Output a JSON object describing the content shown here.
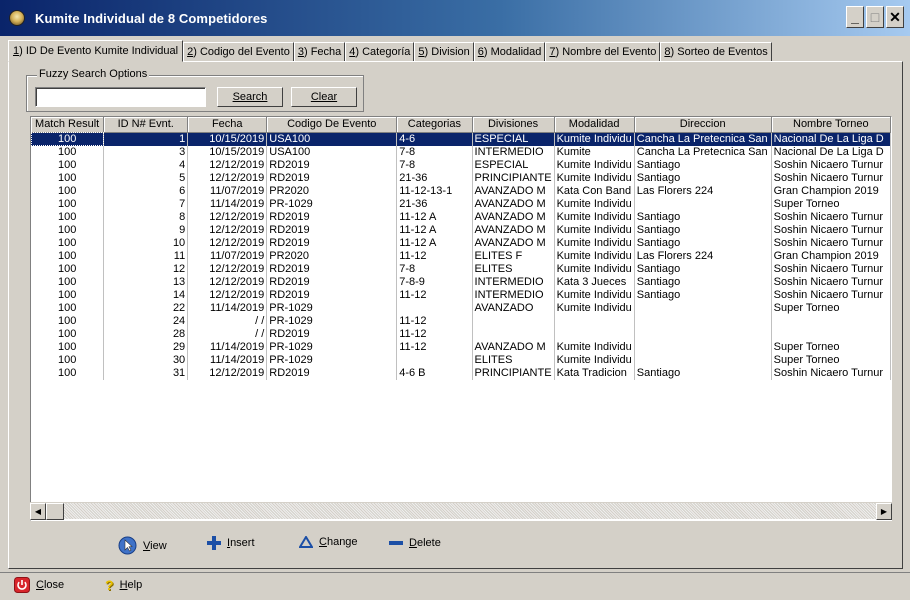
{
  "window": {
    "title": "Kumite Individual de 8 Competidores",
    "min_label": "_",
    "max_label": "□",
    "close_label": "✕"
  },
  "tabs": [
    {
      "num": "1",
      "label": ") ID De Evento Kumite  Individual"
    },
    {
      "num": "2",
      "label": ") Codigo del Evento"
    },
    {
      "num": "3",
      "label": ") Fecha"
    },
    {
      "num": "4",
      "label": ") Categoría"
    },
    {
      "num": "5",
      "label": ") Division"
    },
    {
      "num": "6",
      "label": ") Modalidad"
    },
    {
      "num": "7",
      "label": ") Nombre del Evento"
    },
    {
      "num": "8",
      "label": ") Sorteo de Eventos"
    }
  ],
  "search": {
    "group_label": "Fuzzy Search Options",
    "value": "",
    "search_label": "Search",
    "clear_label": "Clear"
  },
  "grid": {
    "columns": [
      "Match Result",
      "ID N# Evnt.",
      "Fecha",
      "Codigo De Evento",
      "Categorias",
      "Divisiones",
      "Modalidad",
      "Direccion",
      "Nombre Torneo"
    ],
    "rows": [
      [
        "100",
        "1",
        "10/15/2019",
        "USA100",
        "4-6",
        "ESPECIAL",
        "Kumite Individu",
        "Cancha La Pretecnica San",
        "Nacional De La Liga D"
      ],
      [
        "100",
        "3",
        "10/15/2019",
        "USA100",
        "7-8",
        "INTERMEDIO",
        "Kumite",
        "Cancha La Pretecnica San",
        "Nacional De La Liga D"
      ],
      [
        "100",
        "4",
        "12/12/2019",
        "RD2019",
        "7-8",
        "ESPECIAL",
        "Kumite Individu",
        "Santiago",
        "Soshin Nicaero Turnur"
      ],
      [
        "100",
        "5",
        "12/12/2019",
        "RD2019",
        "21-36",
        "PRINCIPIANTE",
        "Kumite Individu",
        "Santiago",
        "Soshin Nicaero Turnur"
      ],
      [
        "100",
        "6",
        "11/07/2019",
        "PR2020",
        "11-12-13-1",
        "AVANZADO M",
        "Kata Con Band",
        "Las Florers 224",
        "Gran Champion 2019"
      ],
      [
        "100",
        "7",
        "11/14/2019",
        "PR-1029",
        "21-36",
        "AVANZADO M",
        "Kumite Individu",
        "",
        "Super Torneo"
      ],
      [
        "100",
        "8",
        "12/12/2019",
        "RD2019",
        "11-12 A",
        "AVANZADO M",
        "Kumite Individu",
        "Santiago",
        "Soshin Nicaero Turnur"
      ],
      [
        "100",
        "9",
        "12/12/2019",
        "RD2019",
        "11-12 A",
        "AVANZADO M",
        "Kumite Individu",
        "Santiago",
        "Soshin Nicaero Turnur"
      ],
      [
        "100",
        "10",
        "12/12/2019",
        "RD2019",
        "11-12 A",
        "AVANZADO M",
        "Kumite Individu",
        "Santiago",
        "Soshin Nicaero Turnur"
      ],
      [
        "100",
        "11",
        "11/07/2019",
        "PR2020",
        "11-12",
        "ELITES F",
        "Kumite Individu",
        "Las Florers 224",
        "Gran Champion 2019"
      ],
      [
        "100",
        "12",
        "12/12/2019",
        "RD2019",
        "7-8",
        "ELITES",
        "Kumite Individu",
        "Santiago",
        "Soshin Nicaero Turnur"
      ],
      [
        "100",
        "13",
        "12/12/2019",
        "RD2019",
        "7-8-9",
        "INTERMEDIO",
        "Kata 3 Jueces",
        "Santiago",
        "Soshin Nicaero Turnur"
      ],
      [
        "100",
        "14",
        "12/12/2019",
        "RD2019",
        "11-12",
        "INTERMEDIO",
        "Kumite Individu",
        "Santiago",
        "Soshin Nicaero Turnur"
      ],
      [
        "100",
        "22",
        "11/14/2019",
        "PR-1029",
        "",
        "AVANZADO",
        "Kumite Individu",
        "",
        "Super Torneo"
      ],
      [
        "100",
        "24",
        "/ /",
        "PR-1029",
        "11-12",
        "",
        "",
        "",
        ""
      ],
      [
        "100",
        "28",
        "/ /",
        "RD2019",
        "11-12",
        "",
        "",
        "",
        ""
      ],
      [
        "100",
        "29",
        "11/14/2019",
        "PR-1029",
        "11-12",
        "AVANZADO M",
        "Kumite Individu",
        "",
        "Super Torneo"
      ],
      [
        "100",
        "30",
        "11/14/2019",
        "PR-1029",
        "",
        "ELITES",
        "Kumite Individu",
        "",
        "Super Torneo"
      ],
      [
        "100",
        "31",
        "12/12/2019",
        "RD2019",
        "4-6 B",
        "PRINCIPIANTE",
        "Kata Tradicion",
        "Santiago",
        "Soshin Nicaero Turnur"
      ]
    ]
  },
  "actions": {
    "view": {
      "key": "V",
      "rest": "iew"
    },
    "insert": {
      "key": "I",
      "rest": "nsert"
    },
    "change": {
      "key": "C",
      "rest": "hange"
    },
    "delete": {
      "key": "D",
      "rest": "elete"
    }
  },
  "footer": {
    "close": {
      "key": "C",
      "rest": "lose"
    },
    "help": {
      "key": "H",
      "rest": "elp"
    }
  },
  "colors": {
    "titlebar": "#0a246a",
    "selection": "#0a246a",
    "icon_blue": "#1c4fa6",
    "close_red": "#d8252b"
  }
}
